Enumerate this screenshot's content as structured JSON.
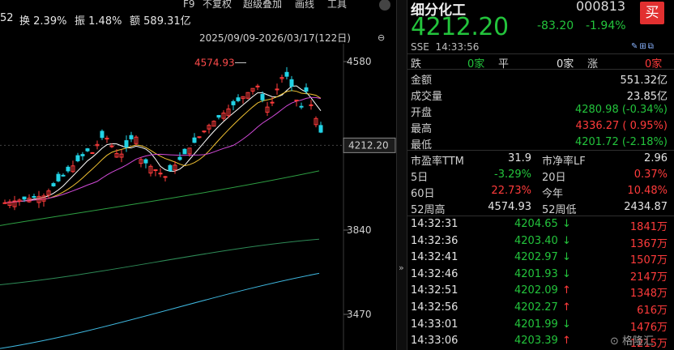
{
  "topbar": {
    "prev_fragment": "52",
    "turnover_label": "换",
    "turnover": "2.39%",
    "amplitude_label": "振",
    "amplitude": "1.48%",
    "amount_label": "额",
    "amount": "589.31亿",
    "menu": [
      "F9",
      "不复权",
      "超级叠加",
      "画线",
      "工具"
    ],
    "range": "2025/09/09-2026/03/17(122日)"
  },
  "chart": {
    "price_labels": [
      "4580",
      "3840",
      "3470"
    ],
    "current_price_tag": "4212.20",
    "high_marker": "4574.93"
  },
  "quote": {
    "name": "细分化工",
    "code": "000813",
    "buy_label": "买",
    "price": "4212.20",
    "change": "-83.20",
    "change_pct": "-1.94%",
    "exchange": "SSE",
    "time": "14:33:56"
  },
  "breadth": {
    "down_label": "跌",
    "down": "0家",
    "flat_label": "平",
    "flat": "0家",
    "up_label": "涨",
    "up": "0家"
  },
  "stats": [
    {
      "label": "金额",
      "value": "551.32亿",
      "color": "w"
    },
    {
      "label": "成交量",
      "value": "23.85亿",
      "color": "w"
    },
    {
      "label": "开盘",
      "value": "4280.98 (-0.34%)",
      "color": "g"
    },
    {
      "label": "最高",
      "value": "4336.27 ( 0.95%)",
      "color": "r"
    },
    {
      "label": "最低",
      "value": "4201.72 (-2.18%)",
      "color": "g"
    }
  ],
  "ratios": [
    {
      "l1": "市盈率TTM",
      "v1": "31.9",
      "c1": "w",
      "l2": "市净率LF",
      "v2": "2.96",
      "c2": "w"
    },
    {
      "l1": "5日",
      "v1": "-3.29%",
      "c1": "g",
      "l2": "20日",
      "v2": "0.37%",
      "c2": "r"
    },
    {
      "l1": "60日",
      "v1": "22.73%",
      "c1": "r",
      "l2": "今年",
      "v2": "10.48%",
      "c2": "r"
    },
    {
      "l1": "52周高",
      "v1": "4574.93",
      "c1": "w",
      "l2": "52周低",
      "v2": "2434.87",
      "c2": "w"
    }
  ],
  "ticks": [
    {
      "time": "14:32:31",
      "price": "4204.65",
      "dir": "down",
      "vol": "1841万"
    },
    {
      "time": "14:32:36",
      "price": "4203.40",
      "dir": "down",
      "vol": "1367万"
    },
    {
      "time": "14:32:41",
      "price": "4202.97",
      "dir": "down",
      "vol": "1507万"
    },
    {
      "time": "14:32:46",
      "price": "4201.93",
      "dir": "down",
      "vol": "2147万"
    },
    {
      "time": "14:32:51",
      "price": "4202.09",
      "dir": "up",
      "vol": "1348万"
    },
    {
      "time": "14:32:56",
      "price": "4202.27",
      "dir": "up",
      "vol": "616万"
    },
    {
      "time": "14:33:01",
      "price": "4201.99",
      "dir": "down",
      "vol": "1476万"
    },
    {
      "time": "14:33:06",
      "price": "4203.39",
      "dir": "up",
      "vol": "1215万"
    }
  ],
  "watermark": "格隆汇"
}
